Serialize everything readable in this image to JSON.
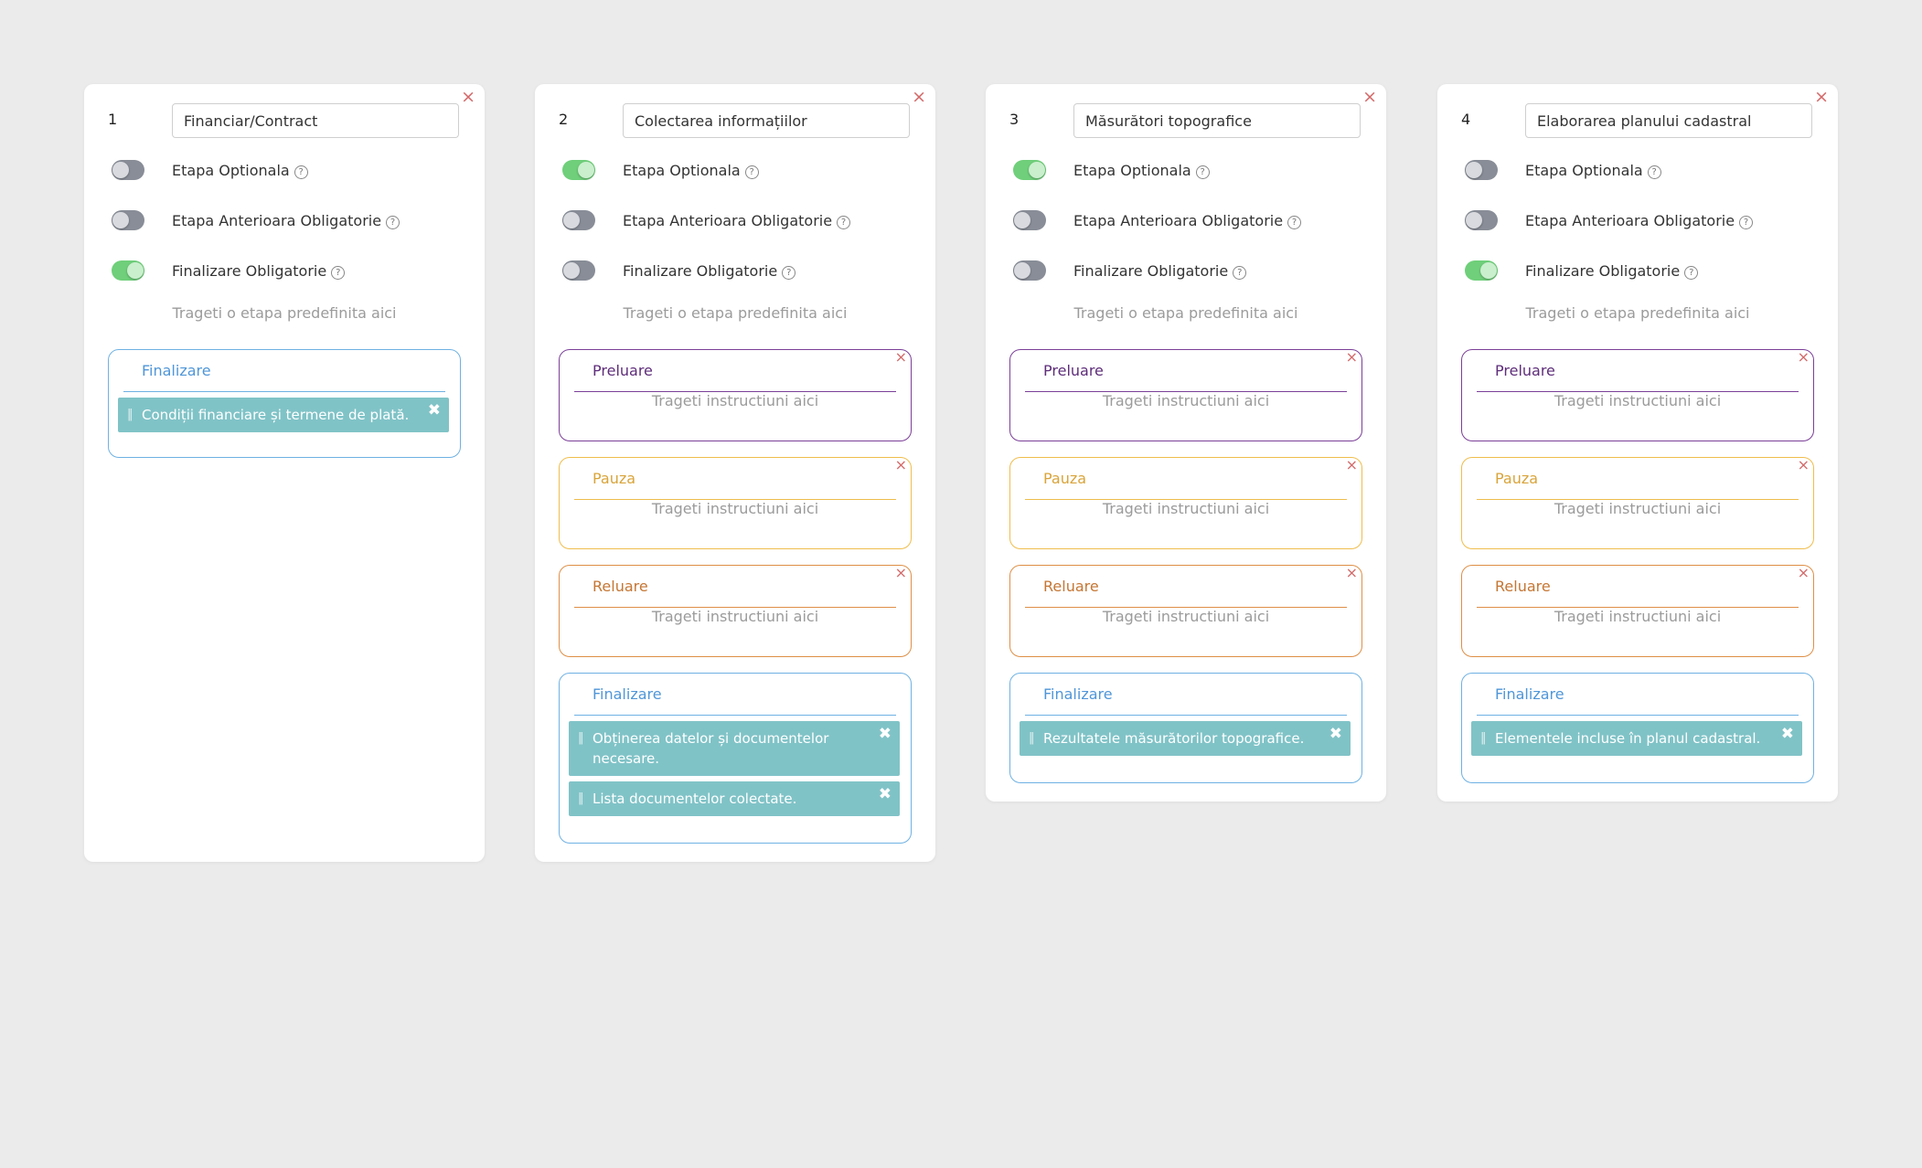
{
  "labels": {
    "optional": "Etapa Optionala",
    "prev_required": "Etapa Anterioara Obligatorie",
    "finish_required": "Finalizare Obligatorie",
    "drop_stage_hint": "Trageti o etapa predefinita aici",
    "drop_instr_hint": "Trageti instructiuni aici",
    "help_glyph": "?",
    "close_glyph": "×",
    "instr_close_glyph": "✖",
    "instr_marker": "‖",
    "section_preluare": "Preluare",
    "section_pauza": "Pauza",
    "section_reluare": "Reluare",
    "section_finalizare": "Finalizare"
  },
  "colors": {
    "toggle_on": "#6fcf7a",
    "toggle_off": "#888d97",
    "instruction_bg": "#80c3c7",
    "close": "#d46a6a",
    "preluare": "#7b3f98",
    "pauza": "#efbd4d",
    "reluare": "#de8f47",
    "finalizare": "#6fb1e3"
  },
  "icons": {
    "card_close": "close-icon",
    "help": "question-circle-icon",
    "instruction_marker": "drag-handle-icon"
  },
  "stages": [
    {
      "number": "1",
      "title": "Financiar/Contract",
      "optional": false,
      "prev_required": false,
      "finish_required": true,
      "finalizare_items": [
        "Condiții financiare și termene de plată."
      ]
    },
    {
      "number": "2",
      "title": "Colectarea informațiilor",
      "optional": true,
      "prev_required": false,
      "finish_required": false,
      "finalizare_items": [
        "Obținerea datelor și documentelor necesare.",
        "Lista documentelor colectate."
      ]
    },
    {
      "number": "3",
      "title": "Măsurători topografice",
      "optional": true,
      "prev_required": false,
      "finish_required": false,
      "finalizare_items": [
        "Rezultatele măsurătorilor topografice."
      ]
    },
    {
      "number": "4",
      "title": "Elaborarea planului cadastral",
      "optional": false,
      "prev_required": false,
      "finish_required": true,
      "finalizare_items": [
        "Elementele incluse în planul cadastral."
      ]
    }
  ]
}
